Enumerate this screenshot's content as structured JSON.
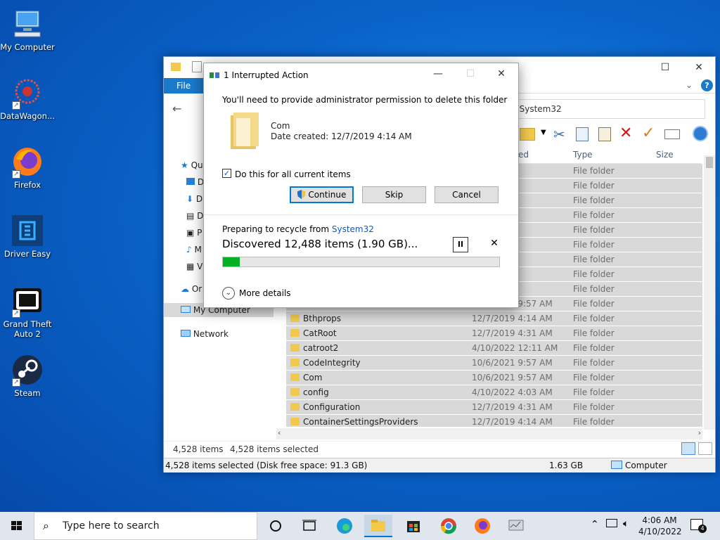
{
  "desktop": {
    "icons": [
      {
        "label": "My Computer"
      },
      {
        "label": "DataWagon..."
      },
      {
        "label": "Firefox"
      },
      {
        "label": "Driver Easy"
      },
      {
        "label": "Grand Theft Auto 2"
      },
      {
        "label": "Steam"
      }
    ]
  },
  "explorer": {
    "file_tab": "File",
    "address": "› System32",
    "nav": {
      "quick_access": "Qu",
      "item_d1": "D",
      "item_d2": "D",
      "item_d3": "D",
      "item_p": "P",
      "item_m": "M",
      "item_v": "V",
      "onedrive": "Or",
      "my_computer": "My Computer",
      "network": "Network"
    },
    "columns": {
      "date": "ed",
      "type": "Type",
      "size": "Size"
    },
    "rows": [
      {
        "name": "",
        "date": "50 AM",
        "type": "File folder"
      },
      {
        "name": "",
        "date": "57 AM",
        "type": "File folder"
      },
      {
        "name": "",
        "date": "14 AM",
        "type": "File folder"
      },
      {
        "name": "",
        "date": "14 AM",
        "type": "File folder"
      },
      {
        "name": "",
        "date": "20 AM",
        "type": "File folder"
      },
      {
        "name": "",
        "date": "57 AM",
        "type": "File folder"
      },
      {
        "name": "",
        "date": "57 AM",
        "type": "File folder"
      },
      {
        "name": "",
        "date": "57 AM",
        "type": "File folder"
      },
      {
        "name": "",
        "date": "57 AM",
        "type": "File folder"
      },
      {
        "name": "boot",
        "date": "10/6/2021 9:57 AM",
        "type": "File folder"
      },
      {
        "name": "Bthprops",
        "date": "12/7/2019 4:14 AM",
        "type": "File folder"
      },
      {
        "name": "CatRoot",
        "date": "12/7/2019 4:31 AM",
        "type": "File folder"
      },
      {
        "name": "catroot2",
        "date": "4/10/2022 12:11 AM",
        "type": "File folder"
      },
      {
        "name": "CodeIntegrity",
        "date": "10/6/2021 9:57 AM",
        "type": "File folder"
      },
      {
        "name": "Com",
        "date": "10/6/2021 9:57 AM",
        "type": "File folder"
      },
      {
        "name": "config",
        "date": "4/10/2022 4:03 AM",
        "type": "File folder"
      },
      {
        "name": "Configuration",
        "date": "12/7/2019 4:31 AM",
        "type": "File folder"
      },
      {
        "name": "ContainerSettingsProviders",
        "date": "12/7/2019 4:14 AM",
        "type": "File folder"
      }
    ],
    "status": {
      "items": "4,528 items",
      "selected": "4,528 items selected"
    },
    "statusbar": {
      "left": "4,528 items selected (Disk free space: 91.3 GB)",
      "size": "1.63 GB",
      "location": "Computer"
    }
  },
  "dialog": {
    "title": "1 Interrupted Action",
    "message": "You'll need to provide administrator permission to delete this folder",
    "item_name": "Com",
    "item_date": "Date created: 12/7/2019 4:14 AM",
    "checkbox_label": "Do this for all current items",
    "continue": "Continue",
    "skip": "Skip",
    "cancel": "Cancel",
    "preparing": "Preparing to recycle from ",
    "source": "System32",
    "discovered": "Discovered 12,488 items (1.90 GB)...",
    "progress": 0.06,
    "more_details": "More details",
    "check_glyph": "✓",
    "pause_glyph": "II",
    "close_glyph": "✕",
    "chevron_glyph": "⌄"
  },
  "taskbar": {
    "search_placeholder": "Type here to search",
    "time": "4:06 AM",
    "date": "4/10/2022",
    "notifications": "4"
  },
  "colors": {
    "accent": "#0078d7",
    "progress": "#06b025",
    "selection": "#d9d9d9"
  }
}
